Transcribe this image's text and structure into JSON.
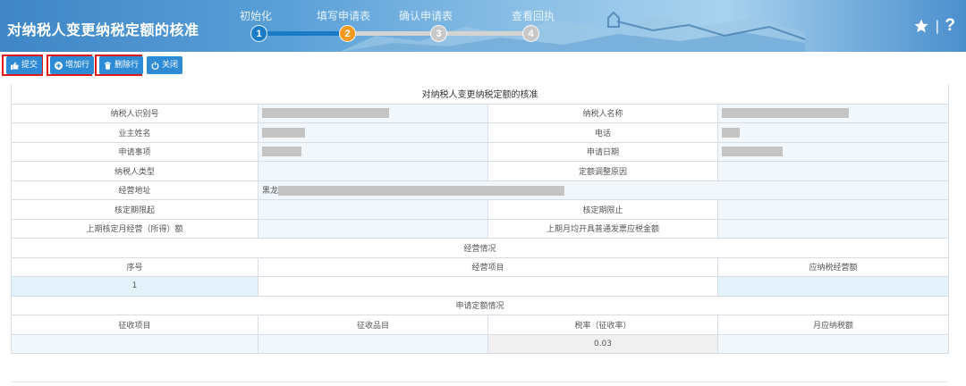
{
  "header": {
    "title": "对纳税人变更纳税定额的核准",
    "steps": [
      {
        "label": "初始化",
        "number": "1",
        "state": "done"
      },
      {
        "label": "填写申请表",
        "number": "2",
        "state": "current"
      },
      {
        "label": "确认申请表",
        "number": "3",
        "state": "pending"
      },
      {
        "label": "查看回执",
        "number": "4",
        "state": "pending"
      }
    ],
    "separator": "|",
    "help": "?"
  },
  "toolbar": {
    "submit_label": "提交",
    "add_row_label": "增加行",
    "delete_row_label": "删除行",
    "close_label": "关闭"
  },
  "form": {
    "title": "对纳税人变更纳税定额的核准",
    "rows": {
      "taxpayer_id": "纳税人识别号",
      "taxpayer_name": "纳税人名称",
      "owner_name": "业主姓名",
      "phone": "电话",
      "apply_item": "申请事项",
      "apply_date": "申请日期",
      "taxpayer_type": "纳税人类型",
      "adjust_reason": "定额调整原因",
      "address": "经营地址",
      "address_value": "黑龙",
      "period_start": "核定期限起",
      "period_end": "核定期限止",
      "prev_monthly": "上期核定月经营（所得）额",
      "prev_invoice": "上期月均开具普通发票应税金额"
    },
    "business_section": {
      "title": "经营情况",
      "headers": [
        "序号",
        "经营项目",
        "应纳税经营额"
      ],
      "rows": [
        {
          "index": "1",
          "item": "",
          "amount": ""
        }
      ]
    },
    "quota_section": {
      "title": "申请定额情况",
      "headers": [
        "征收项目",
        "征收品目",
        "税率（征收率）",
        "月应纳税额"
      ],
      "rows": [
        {
          "project": "",
          "category": "",
          "rate": "0.03",
          "monthly_tax": ""
        }
      ]
    }
  },
  "colors": {
    "header_blue": "#3f86c6",
    "step_done": "#1a7cc4",
    "step_current": "#f39a1e",
    "step_pending": "#c8c8c8",
    "button_blue": "#2d8ad4",
    "highlight_red": "#e01818"
  }
}
